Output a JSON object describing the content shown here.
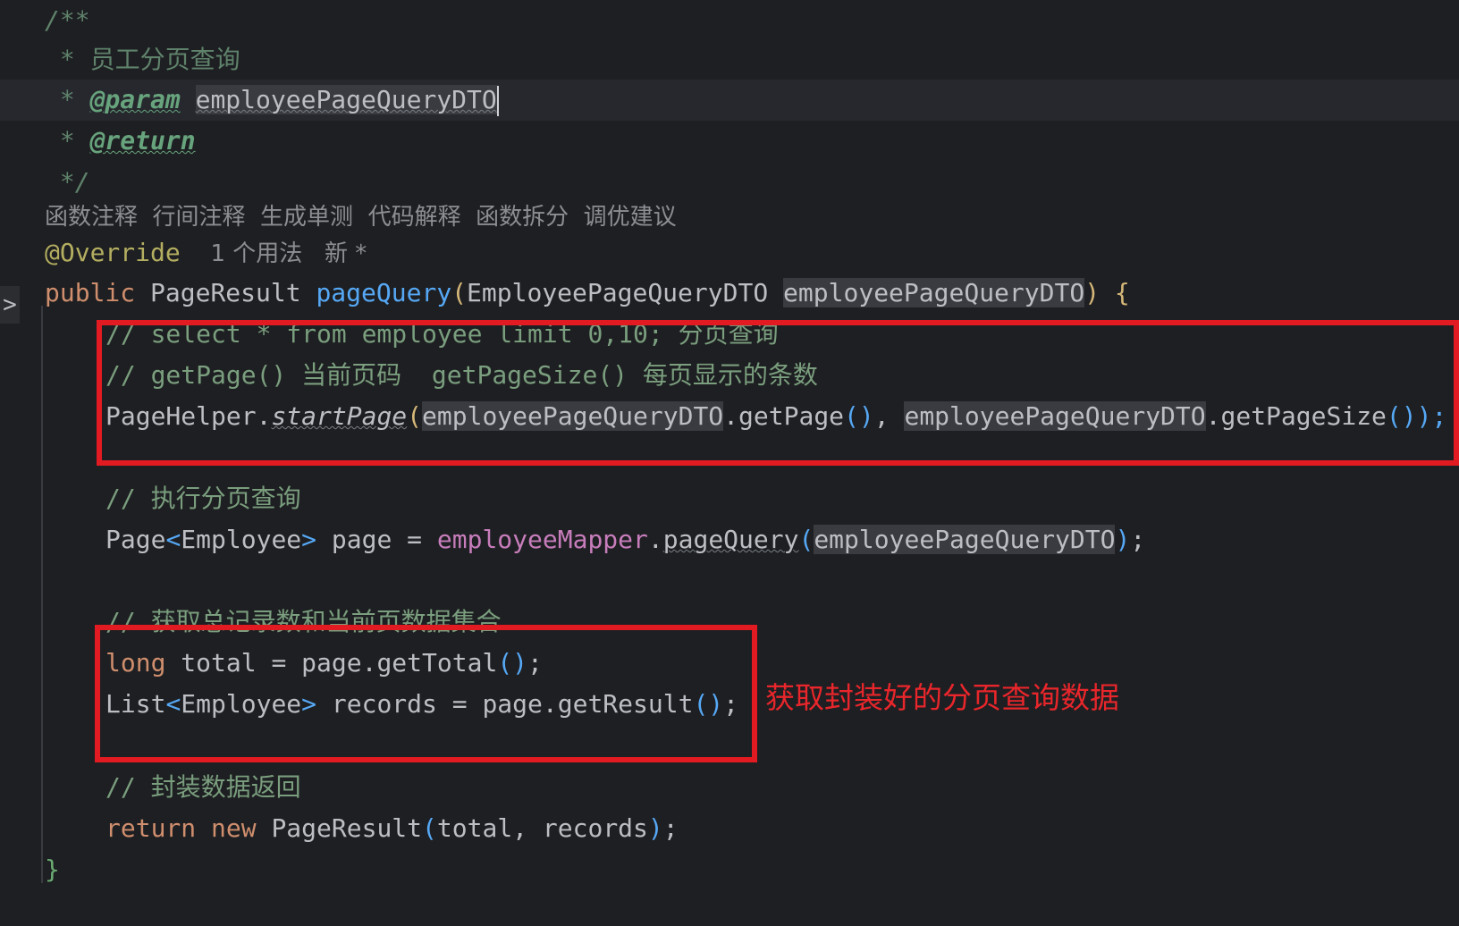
{
  "doc_comment": {
    "open": "/**",
    "summary_prefix": " * ",
    "summary": "员工分页查询",
    "param_prefix": " * ",
    "param_tag": "@param",
    "param_name": "employeePageQueryDTO",
    "return_prefix": " * ",
    "return_tag": "@return",
    "close": " */"
  },
  "ai_actions": "函数注释  行间注释  生成单测  代码解释  函数拆分  调优建议",
  "override_line": {
    "annotation": "@Override",
    "usages": "1 个用法",
    "new_marker": "新 *"
  },
  "signature": {
    "kw_public": "public",
    "return_type": " PageResult ",
    "method_name": "pageQuery",
    "open_paren": "(",
    "param_type": "EmployeePageQueryDTO ",
    "param_name": "employeePageQueryDTO",
    "close_paren": ")",
    "open_brace": " {"
  },
  "body": {
    "comment1_code": "// select * from employee limit 0,10; ",
    "comment1_cn": "分页查询",
    "comment2_a": "// getPage() ",
    "comment2_cn_a": "当前页码",
    "comment2_b": "  getPageSize() ",
    "comment2_cn_b": "每页显示的条数",
    "helper_class": "PageHelper.",
    "helper_method": "startPage",
    "helper_p1": "(",
    "helper_arg1": "employeePageQueryDTO",
    "helper_getpage": ".getPage",
    "helper_p2": "()",
    "helper_comma": ", ",
    "helper_arg2": "employeePageQueryDTO",
    "helper_getpagesize": ".getPageSize",
    "helper_p3": "());",
    "comment3_prefix": "// ",
    "comment3_cn": "执行分页查询",
    "page_type": "Page",
    "page_lt": "<",
    "page_generic": "Employee",
    "page_gt": ">",
    "page_assign": " page = ",
    "mapper_field": "employeeMapper",
    "mapper_dot": ".",
    "mapper_method": "pageQuery",
    "mapper_p_open": "(",
    "mapper_arg": "employeePageQueryDTO",
    "mapper_p_close": ")",
    "mapper_end": ";",
    "comment4_prefix": "// ",
    "comment4_cn": "获取总记录数和当前页数据集合",
    "long_kw": "long",
    "total_assign": " total = page.getTotal",
    "total_parens": "()",
    "total_end": ";",
    "list_type": "List",
    "list_lt": "<",
    "list_generic": "Employee",
    "list_gt": ">",
    "records_assign": " records = page.getResult",
    "records_parens": "()",
    "records_end": ";",
    "comment5_prefix": "// ",
    "comment5_cn": "封装数据返回",
    "return_kw": "return",
    "new_kw": " new",
    "return_expr": " PageResult",
    "return_p_open": "(",
    "return_args": "total, records",
    "return_p_close": ")",
    "return_end": ";",
    "close_brace": "}"
  },
  "gutter_marker": ">",
  "annotation_label": "获取封装好的分页查询数据",
  "colors": {
    "background": "#1e1f22",
    "highlight_box": "#e21b22",
    "annotation_text": "#e8262b"
  }
}
